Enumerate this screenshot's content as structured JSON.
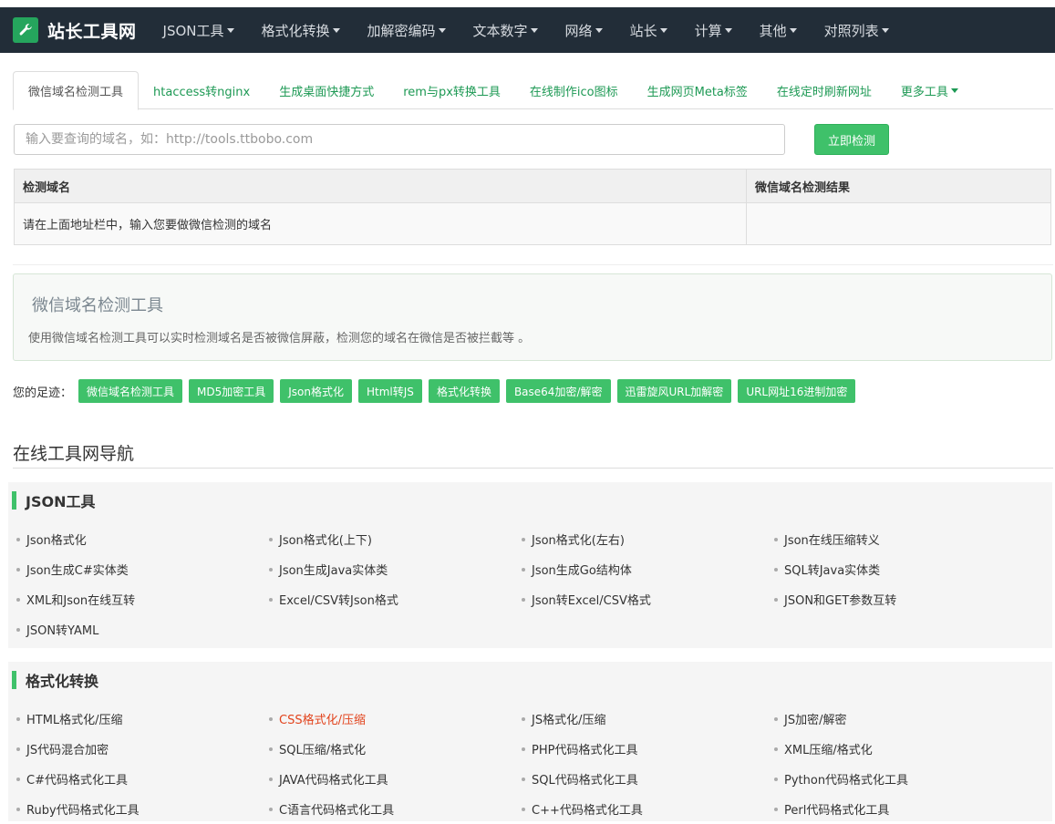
{
  "brand": {
    "title": "站长工具网",
    "icon": "wrench-icon"
  },
  "nav": [
    {
      "label": "JSON工具"
    },
    {
      "label": "格式化转换"
    },
    {
      "label": "加解密编码"
    },
    {
      "label": "文本数字"
    },
    {
      "label": "网络"
    },
    {
      "label": "站长"
    },
    {
      "label": "计算"
    },
    {
      "label": "其他"
    },
    {
      "label": "对照列表"
    }
  ],
  "tabs": [
    {
      "label": "微信域名检测工具",
      "active": true
    },
    {
      "label": "htaccess转nginx"
    },
    {
      "label": "生成桌面快捷方式"
    },
    {
      "label": "rem与px转换工具"
    },
    {
      "label": "在线制作ico图标"
    },
    {
      "label": "生成网页Meta标签"
    },
    {
      "label": "在线定时刷新网址"
    },
    {
      "label": "更多工具"
    }
  ],
  "search": {
    "placeholder": "输入要查询的域名，如：http://tools.ttbobo.com",
    "value": "",
    "button": "立即检测"
  },
  "result_table": {
    "headers": [
      "检测域名",
      "微信域名检测结果"
    ],
    "rows": [
      [
        "请在上面地址栏中，输入您要做微信检测的域名",
        ""
      ]
    ]
  },
  "info": {
    "title": "微信域名检测工具",
    "desc": "使用微信域名检测工具可以实时检测域名是否被微信屏蔽，检测您的域名在微信是否被拦截等 。"
  },
  "footprint": {
    "label": "您的足迹：",
    "tags": [
      "微信域名检测工具",
      "MD5加密工具",
      "Json格式化",
      "Html转JS",
      "格式化转换",
      "Base64加密/解密",
      "迅雷旋风URL加解密",
      "URL网址16进制加密"
    ]
  },
  "nav_heading": "在线工具网导航",
  "sections": [
    {
      "title": "JSON工具",
      "links": [
        [
          "Json格式化",
          " Json格式化(上下)",
          "Json格式化(左右)",
          "Json在线压缩转义"
        ],
        [
          "Json生成C#实体类",
          " Json生成Java实体类",
          "Json生成Go结构体",
          "SQL转Java实体类"
        ],
        [
          "XML和Json在线互转",
          "Excel/CSV转Json格式",
          "Json转Excel/CSV格式",
          "JSON和GET参数互转"
        ],
        [
          "JSON转YAML"
        ]
      ]
    },
    {
      "title": "格式化转换",
      "links": [
        [
          "HTML格式化/压缩",
          " CSS格式化/压缩",
          "JS格式化/压缩",
          "JS加密/解密"
        ],
        [
          " JS代码混合加密",
          "SQL压缩/格式化",
          "PHP代码格式化工具",
          "XML压缩/格式化"
        ],
        [
          "C#代码格式化工具",
          "JAVA代码格式化工具",
          "SQL代码格式化工具",
          "Python代码格式化工具"
        ],
        [
          "Ruby代码格式化工具",
          "C语言代码格式化工具",
          "C++代码格式化工具",
          "Perl代码格式化工具"
        ]
      ]
    }
  ],
  "colors": {
    "nav_bg": "#222d38",
    "accent": "#3fc16a",
    "link_green": "#1d9954",
    "highlight_red": "#e2441d"
  }
}
